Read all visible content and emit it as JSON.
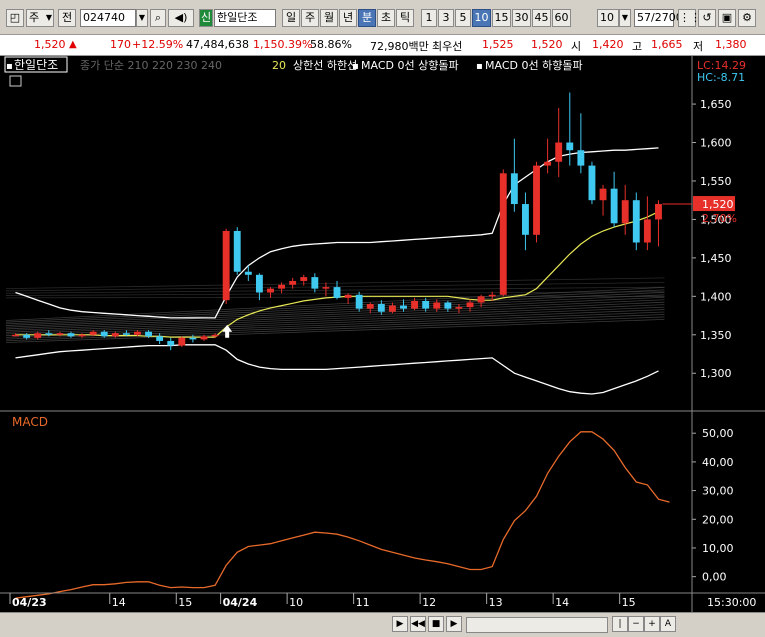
{
  "toolbar": {
    "type_btn": "주",
    "all_btn": "전",
    "code": "024740",
    "stock_name": "한일단조",
    "credit_tag": "신",
    "periods": [
      "일",
      "주",
      "월",
      "년",
      "분",
      "초",
      "틱"
    ],
    "active_period": "분",
    "intervals": [
      "1",
      "3",
      "5",
      "10",
      "15",
      "30",
      "45",
      "60"
    ],
    "active_interval": "10",
    "count_value": "10",
    "page_indicator": "57",
    "page_total": "/2700"
  },
  "quote": {
    "price": "1,520",
    "change": "170",
    "change_pct": "+12.59%",
    "volume": "47,484,638",
    "volume_pct": "1,150.39%",
    "turnover": "58.86%",
    "amount": "72,980백만",
    "priority_label": "최우선",
    "ask": "1,525",
    "bid": "1,520",
    "open_label": "시",
    "open": "1,420",
    "high_label": "고",
    "high": "1,665",
    "low_label": "저",
    "low": "1,380"
  },
  "price_panel": {
    "stock_label": "한일단조",
    "legend_ma": "종가 단순 210 220 230 240",
    "legend_20": "20",
    "legend_limits": "상한선 하한선",
    "legend_macd_up": "MACD 0선 상향돌파",
    "legend_macd_down": "MACD 0선 하향돌파",
    "lc": "LC:14.29",
    "hc": "HC:-8.71",
    "current_price_tag": "1,520",
    "current_pct_tag": "2.70%"
  },
  "macd_panel": {
    "label": "MACD"
  },
  "colors": {
    "up": "#e8302a",
    "down": "#3fc8f0",
    "ma20": "#e8e855",
    "band": "#ffffff",
    "macd": "#e86a2a"
  },
  "chart_data": [
    {
      "type": "candlestick",
      "title": "한일단조",
      "ylim": [
        1260,
        1680
      ],
      "y_ticks": [
        1300,
        1350,
        1400,
        1450,
        1500,
        1550,
        1600,
        1650
      ],
      "y_tick_labels": [
        "1,300",
        "1,350",
        "1,400",
        "1,450",
        "1,500",
        "1,550",
        "1,600",
        "1,650"
      ],
      "x_labels": [
        {
          "i": 0,
          "label": "04/23"
        },
        {
          "i": 9,
          "label": "14"
        },
        {
          "i": 15,
          "label": "15"
        },
        {
          "i": 19,
          "label": "04/24"
        },
        {
          "i": 25,
          "label": "10"
        },
        {
          "i": 31,
          "label": "11"
        },
        {
          "i": 37,
          "label": "12"
        },
        {
          "i": 43,
          "label": "13"
        },
        {
          "i": 49,
          "label": "14"
        },
        {
          "i": 55,
          "label": "15"
        }
      ],
      "candles": [
        [
          1350,
          1352,
          1348,
          1350
        ],
        [
          1350,
          1352,
          1344,
          1346
        ],
        [
          1346,
          1354,
          1344,
          1352
        ],
        [
          1352,
          1356,
          1348,
          1350
        ],
        [
          1350,
          1354,
          1348,
          1352
        ],
        [
          1352,
          1354,
          1346,
          1348
        ],
        [
          1348,
          1352,
          1346,
          1350
        ],
        [
          1350,
          1356,
          1348,
          1354
        ],
        [
          1354,
          1356,
          1346,
          1348
        ],
        [
          1348,
          1354,
          1346,
          1352
        ],
        [
          1352,
          1356,
          1348,
          1350
        ],
        [
          1350,
          1356,
          1348,
          1354
        ],
        [
          1354,
          1356,
          1346,
          1348
        ],
        [
          1348,
          1352,
          1338,
          1342
        ],
        [
          1342,
          1346,
          1330,
          1336
        ],
        [
          1336,
          1348,
          1334,
          1346
        ],
        [
          1346,
          1350,
          1340,
          1344
        ],
        [
          1344,
          1350,
          1342,
          1348
        ],
        [
          1348,
          1352,
          1346,
          1350
        ],
        [
          1395,
          1488,
          1390,
          1485
        ],
        [
          1485,
          1490,
          1428,
          1432
        ],
        [
          1432,
          1440,
          1420,
          1428
        ],
        [
          1428,
          1430,
          1395,
          1405
        ],
        [
          1405,
          1412,
          1398,
          1410
        ],
        [
          1410,
          1418,
          1404,
          1415
        ],
        [
          1415,
          1424,
          1410,
          1420
        ],
        [
          1420,
          1428,
          1414,
          1425
        ],
        [
          1425,
          1430,
          1405,
          1410
        ],
        [
          1410,
          1418,
          1400,
          1412
        ],
        [
          1412,
          1420,
          1396,
          1398
        ],
        [
          1398,
          1404,
          1390,
          1402
        ],
        [
          1402,
          1406,
          1380,
          1384
        ],
        [
          1384,
          1392,
          1378,
          1390
        ],
        [
          1390,
          1395,
          1376,
          1380
        ],
        [
          1380,
          1392,
          1378,
          1388
        ],
        [
          1388,
          1396,
          1380,
          1384
        ],
        [
          1384,
          1398,
          1382,
          1394
        ],
        [
          1394,
          1398,
          1380,
          1384
        ],
        [
          1384,
          1396,
          1380,
          1392
        ],
        [
          1392,
          1394,
          1380,
          1384
        ],
        [
          1384,
          1390,
          1378,
          1386
        ],
        [
          1386,
          1396,
          1380,
          1392
        ],
        [
          1392,
          1402,
          1386,
          1400
        ],
        [
          1400,
          1406,
          1394,
          1402
        ],
        [
          1402,
          1565,
          1400,
          1560
        ],
        [
          1560,
          1605,
          1510,
          1520
        ],
        [
          1520,
          1535,
          1460,
          1480
        ],
        [
          1480,
          1575,
          1470,
          1570
        ],
        [
          1570,
          1605,
          1560,
          1575
        ],
        [
          1575,
          1645,
          1555,
          1600
        ],
        [
          1600,
          1665,
          1570,
          1590
        ],
        [
          1590,
          1638,
          1560,
          1570
        ],
        [
          1570,
          1575,
          1520,
          1525
        ],
        [
          1525,
          1545,
          1505,
          1540
        ],
        [
          1540,
          1562,
          1490,
          1495
        ],
        [
          1495,
          1545,
          1480,
          1525
        ],
        [
          1525,
          1535,
          1460,
          1470
        ],
        [
          1470,
          1530,
          1460,
          1500
        ],
        [
          1500,
          1525,
          1465,
          1520
        ]
      ],
      "ma20": [
        1350,
        1350,
        1350,
        1350,
        1350,
        1350,
        1350,
        1350,
        1349,
        1349,
        1349,
        1349,
        1348,
        1348,
        1347,
        1347,
        1347,
        1347,
        1347,
        1360,
        1370,
        1376,
        1381,
        1385,
        1388,
        1391,
        1394,
        1396,
        1398,
        1399,
        1400,
        1400,
        1400,
        1400,
        1400,
        1400,
        1400,
        1400,
        1400,
        1400,
        1398,
        1396,
        1395,
        1395,
        1398,
        1400,
        1402,
        1410,
        1425,
        1440,
        1455,
        1468,
        1478,
        1485,
        1490,
        1494,
        1498,
        1503,
        1510
      ],
      "bollinger_upper": [
        1405,
        1400,
        1395,
        1390,
        1385,
        1382,
        1380,
        1379,
        1378,
        1377,
        1376,
        1375,
        1374,
        1373,
        1372,
        1372,
        1372,
        1372,
        1372,
        1400,
        1425,
        1440,
        1450,
        1458,
        1462,
        1465,
        1467,
        1468,
        1469,
        1470,
        1470,
        1470,
        1470,
        1471,
        1472,
        1473,
        1474,
        1475,
        1476,
        1477,
        1478,
        1479,
        1480,
        1482,
        1520,
        1545,
        1555,
        1565,
        1575,
        1582,
        1585,
        1587,
        1588,
        1589,
        1590,
        1590,
        1591,
        1592,
        1593
      ],
      "bollinger_lower": [
        1320,
        1322,
        1324,
        1326,
        1328,
        1329,
        1330,
        1331,
        1332,
        1333,
        1334,
        1335,
        1336,
        1336,
        1336,
        1337,
        1337,
        1337,
        1337,
        1330,
        1318,
        1312,
        1308,
        1306,
        1305,
        1305,
        1305,
        1305,
        1305,
        1306,
        1307,
        1308,
        1309,
        1310,
        1311,
        1312,
        1313,
        1314,
        1315,
        1316,
        1317,
        1318,
        1319,
        1320,
        1310,
        1300,
        1295,
        1290,
        1285,
        1280,
        1276,
        1274,
        1273,
        1275,
        1280,
        1285,
        1290,
        1296,
        1303
      ],
      "ma_long_top": [
        1398,
        1412
      ],
      "ma_long_bottom": [
        1340,
        1370
      ],
      "current_price": 1520
    },
    {
      "type": "line",
      "title": "MACD",
      "ylim": [
        -5,
        56
      ],
      "y_ticks": [
        0,
        10,
        20,
        30,
        40,
        50
      ],
      "y_tick_labels": [
        "0,00",
        "10,00",
        "20,00",
        "30,00",
        "40,00",
        "50,00"
      ],
      "values": [
        -7.5,
        -7.0,
        -6.5,
        -6.0,
        -5.2,
        -4.5,
        -3.6,
        -2.8,
        -2.8,
        -2.5,
        -2.0,
        -1.8,
        -1.8,
        -3.0,
        -3.8,
        -3.6,
        -3.8,
        -3.8,
        -3.0,
        4.0,
        8.5,
        10.5,
        11.0,
        11.5,
        12.5,
        13.5,
        14.5,
        15.5,
        15.2,
        14.8,
        13.8,
        12.5,
        11.0,
        9.5,
        8.5,
        7.5,
        6.5,
        5.8,
        5.2,
        4.5,
        3.5,
        2.5,
        2.5,
        3.5,
        13.0,
        19.5,
        23.0,
        28.0,
        36.0,
        42.0,
        47.0,
        50.5,
        50.5,
        48.0,
        44.0,
        38.0,
        33.0,
        32.0,
        27.0,
        26.0
      ]
    }
  ]
}
